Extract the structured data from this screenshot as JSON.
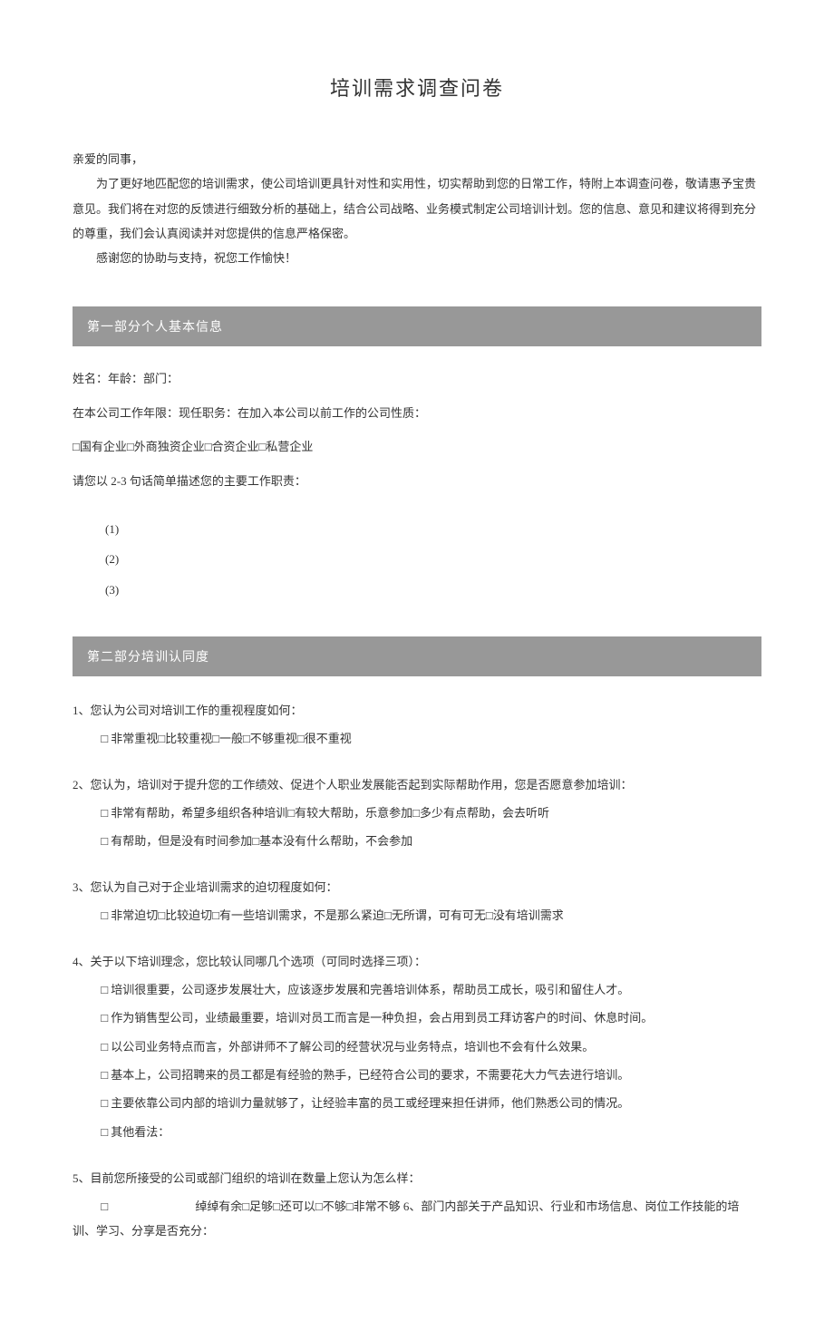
{
  "title": "培训需求调查问卷",
  "intro": {
    "salutation": "亲爱的同事，",
    "p1": "为了更好地匹配您的培训需求，使公司培训更具针对性和实用性，切实帮助到您的日常工作，特附上本调查问卷，敬请惠予宝贵意见。我们将在对您的反馈进行细致分析的基础上，结合公司战略、业务模式制定公司培训计划。您的信息、意见和建议将得到充分的尊重，我们会认真阅读并对您提供的信息严格保密。",
    "p2": "感谢您的协助与支持，祝您工作愉快！"
  },
  "section1": {
    "header": "第一部分个人基本信息",
    "line1": "姓名：年龄：部门：",
    "line2": "在本公司工作年限：现任职务：在加入本公司以前工作的公司性质：",
    "line3": "□国有企业□外商独资企业□合资企业□私营企业",
    "line4": "请您以 2-3 句话简单描述您的主要工作职责：",
    "items": {
      "i1": "(1)",
      "i2": "(2)",
      "i3": "(3)"
    }
  },
  "section2": {
    "header": "第二部分培训认同度",
    "q1": {
      "text": "1、您认为公司对培训工作的重视程度如何：",
      "opts": "□ 非常重视□比较重视□一般□不够重视□很不重视"
    },
    "q2": {
      "text": "2、您认为，培训对于提升您的工作绩效、促进个人职业发展能否起到实际帮助作用，您是否愿意参加培训：",
      "opts1": "□ 非常有帮助，希望多组织各种培训□有较大帮助，乐意参加□多少有点帮助，会去听听",
      "opts2": "□ 有帮助，但是没有时间参加□基本没有什么帮助，不会参加"
    },
    "q3": {
      "text": "3、您认为自己对于企业培训需求的迫切程度如何：",
      "opts": "□ 非常迫切□比较迫切□有一些培训需求，不是那么紧迫□无所谓，可有可无□没有培训需求"
    },
    "q4": {
      "text": "4、关于以下培训理念，您比较认同哪几个选项（可同时选择三项）：",
      "o1": "□ 培训很重要，公司逐步发展壮大，应该逐步发展和完善培训体系，帮助员工成长，吸引和留住人才。",
      "o2": "□ 作为销售型公司，业绩最重要，培训对员工而言是一种负担，会占用到员工拜访客户的时间、休息时间。",
      "o3": "□ 以公司业务特点而言，外部讲师不了解公司的经营状况与业务特点，培训也不会有什么效果。",
      "o4": "□ 基本上，公司招聘来的员工都是有经验的熟手，已经符合公司的要求，不需要花大力气去进行培训。",
      "o5": "□ 主要依靠公司内部的培训力量就够了，让经验丰富的员工或经理来担任讲师，他们熟悉公司的情况。",
      "o6": "□ 其他看法："
    },
    "q5": {
      "text": "5、目前您所接受的公司或部门组织的培训在数量上您认为怎么样：",
      "opts_lead": "□",
      "opts_rest": "绰绰有余□足够□还可以□不够□非常不够 6、部门内部关于产品知识、行业和市场信息、岗位工作技能的培训、学习、分享是否充分："
    }
  }
}
